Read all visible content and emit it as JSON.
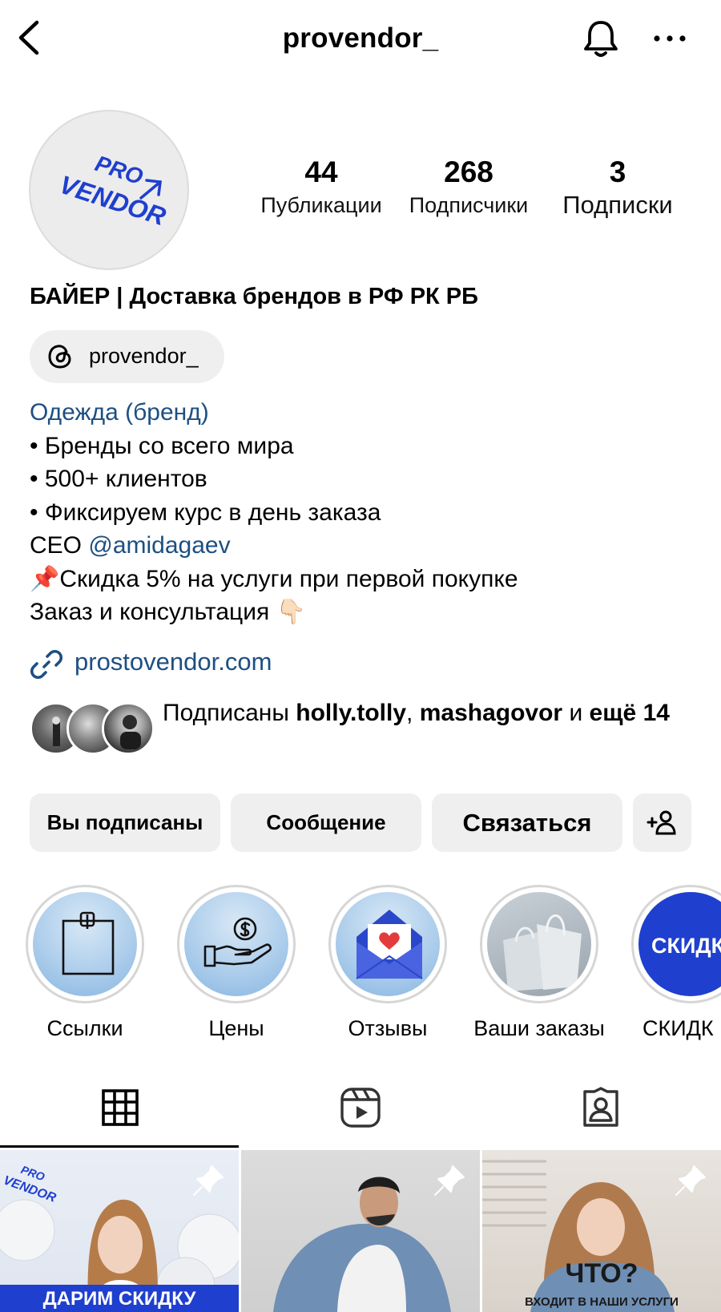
{
  "header": {
    "username": "provendor_"
  },
  "profile": {
    "avatar_text_top": "PRO",
    "avatar_text_bottom": "VENDOR",
    "stats": [
      {
        "value": "44",
        "label": "Публикации"
      },
      {
        "value": "268",
        "label": "Подписчики"
      },
      {
        "value": "3",
        "label": "Подписки"
      }
    ],
    "name": "БАЙЕР | Доставка брендов в РФ РК РБ",
    "threads_handle": "provendor_",
    "category": "Одежда (бренд)",
    "bio": {
      "line1": "• Бренды со всего мира",
      "line2": "• 500+ клиентов",
      "line3": "• Фиксируем курс в день заказа",
      "line4_prefix": "CEO ",
      "line4_mention": "@amidagaev",
      "line5_emoji": "📌",
      "line5_text": "Скидка 5% на услуги при первой покупке",
      "line6_text": "Заказ и консультация ",
      "line6_emoji": "👇🏻"
    },
    "website": "prostovendor.com",
    "followed_by": {
      "prefix": "Подписаны ",
      "user1": "holly.tolly",
      "separator": ", ",
      "user2": "mashagovor",
      "conjunction": " и ",
      "more": "ещё 14"
    }
  },
  "actions": {
    "following": "Вы подписаны",
    "message": "Сообщение",
    "contact": "Связаться"
  },
  "highlights": [
    {
      "label": "Ссылки",
      "icon": "pinned-note-icon"
    },
    {
      "label": "Цены",
      "icon": "hand-coin-icon"
    },
    {
      "label": "Отзывы",
      "icon": "envelope-heart-icon"
    },
    {
      "label": "Ваши заказы",
      "icon": "shopping-bags-photo"
    },
    {
      "label": "СКИДК",
      "icon": "discount-badge",
      "badge_text": "СКИДК"
    }
  ],
  "tabs": {
    "active": "grid",
    "items": [
      "grid-icon",
      "reels-icon",
      "tagged-icon"
    ]
  },
  "posts": [
    {
      "caption": "ДАРИМ СКИДКУ",
      "logo_top": "PRO",
      "logo_bottom": "VENDOR",
      "pinned": true
    },
    {
      "caption": "",
      "pinned": true
    },
    {
      "caption_big": "ЧТО?",
      "caption_small": "ВХОДИТ В НАШИ УСЛУГИ",
      "pinned": true
    }
  ],
  "colors": {
    "link": "#1d4f82",
    "button_bg": "#efefef",
    "brand_blue": "#1f3fcf"
  }
}
